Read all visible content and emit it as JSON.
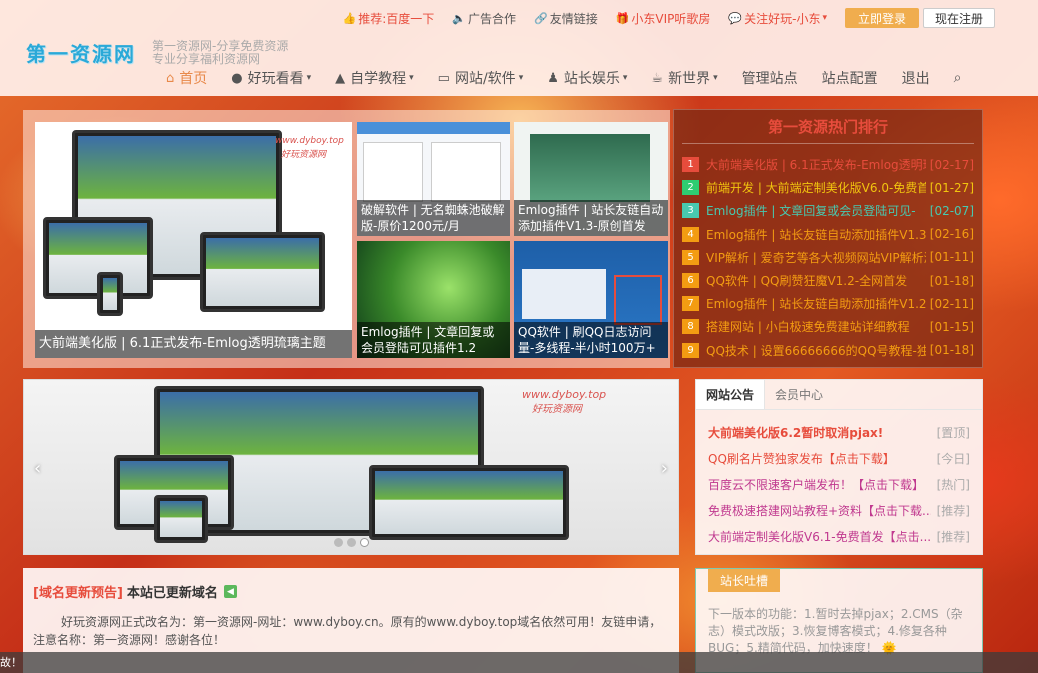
{
  "header": {
    "logo": "第一资源网",
    "slogan_line1": "第一资源网-分享免费资源",
    "slogan_line2": "专业分享福利资源网"
  },
  "topbar": {
    "recommend": "推荐:百度一下",
    "ads": "广告合作",
    "friends": "友情链接",
    "vip": "小东VIP听歌房",
    "follow": "关注好玩-小东",
    "login": "立即登录",
    "register": "现在注册"
  },
  "nav": {
    "items": [
      {
        "label": "首页",
        "icon": "home-icon"
      },
      {
        "label": "好玩看看",
        "icon": "comments-icon"
      },
      {
        "label": "自学教程",
        "icon": "graduation-cap-icon"
      },
      {
        "label": "网站/软件",
        "icon": "desktop-icon"
      },
      {
        "label": "站长娱乐",
        "icon": "users-icon"
      },
      {
        "label": "新世界",
        "icon": "coffee-icon"
      },
      {
        "label": "管理站点"
      },
      {
        "label": "站点配置"
      },
      {
        "label": "退出"
      }
    ]
  },
  "feature": {
    "main_caption": "大前端美化版 | 6.1正式发布-Emlog透明琉璃主题",
    "watermark": "www.dyboy.top",
    "watermark_sub": "好玩资源网",
    "tiles": [
      {
        "caption": "破解软件 | 无名蜘蛛池破解版-原价1200元/月"
      },
      {
        "caption": "Emlog插件 | 站长友链自动添加插件V1.3-原创首发"
      },
      {
        "caption": "Emlog插件 | 文章回复或会员登陆可见插件1.2"
      },
      {
        "caption": "QQ软件 | 刷QQ日志访问量-多线程-半小时100万+"
      }
    ]
  },
  "rank": {
    "title": "第一资源热门排行",
    "items": [
      {
        "num": "1",
        "text": "大前端美化版 | 6.1正式发布-Emlog透明琉",
        "date": "[02-17]",
        "color": "#e74c3c",
        "badge": "#e74c3c"
      },
      {
        "num": "2",
        "text": "前端开发 | 大前端定制美化版V6.0-免费首发",
        "date": "[01-27]",
        "color": "#f1c40f",
        "badge": "#2ecc71"
      },
      {
        "num": "3",
        "text": "Emlog插件 | 文章回复或会员登陆可见-",
        "date": "[02-07]",
        "color": "#48c9b0",
        "badge": "#48c9b0"
      },
      {
        "num": "4",
        "text": "Emlog插件 | 站长友链自动添加插件V1.3-原",
        "date": "[02-16]",
        "color": "#f39c12",
        "badge": "#f39c12"
      },
      {
        "num": "5",
        "text": "VIP解析 | 爱奇艺等各大视频网站VIP解析源",
        "date": "[01-11]",
        "color": "#f39c12",
        "badge": "#f39c12"
      },
      {
        "num": "6",
        "text": "QQ软件 | QQ刷赞狂魔V1.2-全网首发",
        "date": "[01-18]",
        "color": "#f39c12",
        "badge": "#f39c12"
      },
      {
        "num": "7",
        "text": "Emlog插件 | 站长友链自助添加插件V1.2-美",
        "date": "[02-11]",
        "color": "#f39c12",
        "badge": "#f39c12"
      },
      {
        "num": "8",
        "text": "搭建网站 | 小白极速免费建站详细教程",
        "date": "[01-15]",
        "color": "#f39c12",
        "badge": "#f39c12"
      },
      {
        "num": "9",
        "text": "QQ技术 | 设置66666666的QQ号教程-独家",
        "date": "[01-18]",
        "color": "#f39c12",
        "badge": "#f39c12"
      }
    ]
  },
  "slider": {
    "watermark": "www.dyboy.top",
    "watermark_sub": "好玩资源网",
    "prev": "‹",
    "next": "›"
  },
  "notice": {
    "tabs": [
      "网站公告",
      "会员中心"
    ],
    "items": [
      {
        "text": "大前端美化版6.2暂时取消pjax!",
        "tag": "[置顶]",
        "color": "#e74c3c",
        "bold": true
      },
      {
        "text": "QQ刷名片赞独家发布【点击下载】",
        "tag": "[今日]",
        "color": "#e74c3c"
      },
      {
        "text": "百度云不限速客户端发布！【点击下载】",
        "tag": "[热门]",
        "color": "#c0398f"
      },
      {
        "text": "免费极速搭建网站教程+资料【点击下载...",
        "tag": "[推荐]",
        "color": "#c0398f"
      },
      {
        "text": "大前端定制美化版V6.1-免费首发【点击...",
        "tag": "[推荐]",
        "color": "#c0398f"
      }
    ]
  },
  "announce": {
    "tag": "[域名更新预告]",
    "title": "本站已更新域名",
    "body": "好玩资源网正式改名为：第一资源网-网址：www.dyboy.cn。原有的www.dyboy.top域名依然可用！友链申请，注意名称：第一资源网！感谢各位！"
  },
  "tucao": {
    "label": "站长吐槽",
    "body": "下一版本的功能：1.暂时去掉pjax；2.CMS（杂志）模式改版；3.恢复博客模式；4.修复各种BUG；5.精简代码，加快速度！"
  },
  "bottombar": {
    "text": "故！"
  }
}
